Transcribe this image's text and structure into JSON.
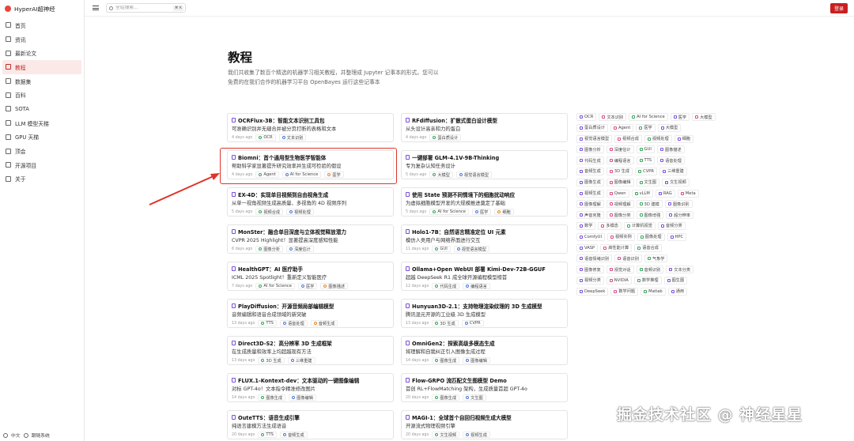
{
  "brand": {
    "name": "HyperAI超神经"
  },
  "nav": [
    {
      "label": "首页",
      "icon": "home-icon"
    },
    {
      "label": "资讯",
      "icon": "news-icon"
    },
    {
      "label": "最新论文",
      "icon": "paper-icon"
    },
    {
      "label": "教程",
      "icon": "book-icon",
      "active": true
    },
    {
      "label": "数据集",
      "icon": "dataset-icon"
    },
    {
      "label": "百科",
      "icon": "wiki-icon"
    },
    {
      "label": "SOTA",
      "icon": "trophy-icon"
    },
    {
      "label": "LLM 模型天梯",
      "icon": "ladder-icon"
    },
    {
      "label": "GPU 天梯",
      "icon": "gpu-icon"
    },
    {
      "label": "顶会",
      "icon": "conference-icon"
    },
    {
      "label": "开源项目",
      "icon": "opensource-icon"
    },
    {
      "label": "关于",
      "icon": "info-icon"
    }
  ],
  "footer": {
    "language": "中文",
    "theme": "跟随系统"
  },
  "search": {
    "placeholder": "全站搜索...",
    "shortcut": "⌘ K"
  },
  "login_label": "登录",
  "page": {
    "title": "教程",
    "description": "我们共收集了数百个精选的机器学习相关教程，并整理成 Jupyter 记事本的形式。您可以免费的在我们合作的机器学习平台 OpenBayes 运行这些记事本"
  },
  "cards": [
    {
      "title": "OCRFlux-3B：智能文本识别工具包",
      "subtitle": "可准确识别并无缝合并被分页打断的表格和文本",
      "days": "4 days ago",
      "tags": [
        "OCR",
        "文本识别"
      ]
    },
    {
      "title": "RFdiffusion：扩散式蛋白设计模型",
      "subtitle": "从头设计高亲和力的蛋白",
      "days": "4 days ago",
      "tags": [
        "蛋白质设计"
      ]
    },
    {
      "title": "Biomni：首个通用型生物医学智能体",
      "subtitle": "帮助科学家显著提升研究效率并生成可检验的假设",
      "days": "4 days ago",
      "tags": [
        "Agent",
        "AI for Science",
        "医学"
      ]
    },
    {
      "title": "一键部署 GLM-4.1V-9B-Thinking",
      "subtitle": "专为复杂认知任务设计",
      "days": "5 days ago",
      "tags": [
        "大模型",
        "视觉语言模型"
      ]
    },
    {
      "title": "EX-4D：实现单目视频到自由视角生成",
      "subtitle": "从单一视角视频生成高质量、多视角的 4D 视频序列",
      "days": "5 days ago",
      "tags": [
        "视频合成",
        "视频处理"
      ]
    },
    {
      "title": "使用 State 预测不同情境下的细胞扰动响应",
      "subtitle": "为虚拟细胞模型开发的大规模推进奠定了基础",
      "days": "5 days ago",
      "tags": [
        "AI for Science",
        "医学",
        "细胞"
      ]
    },
    {
      "title": "MonSter：融合单目深度与立体视觉释放潜力",
      "subtitle": "CVPR 2025 Highlight！显著提高深度感知性能",
      "days": "6 days ago",
      "tags": [
        "图像分析",
        "深度估计"
      ]
    },
    {
      "title": "Holo1-7B：自然语言精准定位 UI 元素",
      "subtitle": "模仿人类用户与网络界面进行交互",
      "days": "11 days ago",
      "tags": [
        "GUI",
        "视觉语言模型"
      ]
    },
    {
      "title": "HealthGPT：AI 医疗助手",
      "subtitle": "ICML 2025 Spotlight！重新定义智能医疗",
      "days": "7 days ago",
      "tags": [
        "AI for Science",
        "医学",
        "图像描述"
      ]
    },
    {
      "title": "Ollama+Open WebUI 部署 Kimi-Dev-72B-GGUF",
      "subtitle": "超越 DeepSeek R1 成全球开源编程模型榜首",
      "days": "12 days ago",
      "tags": [
        "代码生成",
        "编程语言"
      ]
    },
    {
      "title": "PlayDiffusion：开源音频局部编辑模型",
      "subtitle": "音频编辑和语音合成领域的新突破",
      "days": "13 days ago",
      "tags": [
        "TTS",
        "语音处理",
        "音频生成"
      ]
    },
    {
      "title": "Hunyuan3D-2.1：支持物理渲染纹理的 3D 生成模型",
      "subtitle": "腾讯混元开源的工业级 3D 生成模型",
      "days": "13 days ago",
      "tags": [
        "3D 生成",
        "CVPR"
      ]
    },
    {
      "title": "Direct3D-S2：高分辨率 3D 生成框架",
      "subtitle": "在生成质量和效率上均超越现有方法",
      "days": "13 days ago",
      "tags": [
        "3D 生成",
        "三维重建"
      ]
    },
    {
      "title": "OmniGen2：探索高级多模态生成",
      "subtitle": "将理解和自我纠正引入图像生成过程",
      "days": "14 days ago",
      "tags": [
        "图像生成",
        "图像编辑"
      ]
    },
    {
      "title": "FLUX.1-Kontext-dev：文本驱动的一键图像编辑",
      "subtitle": "对标 GPT-4o！文本指令精准修改图片",
      "days": "14 days ago",
      "tags": [
        "图像生成",
        "图像编辑"
      ]
    },
    {
      "title": "Flow-GRPO 流匹配文生图模型 Demo",
      "subtitle": "首创 RL+FlowMatching 架构，生成质量首超 GPT-4o",
      "days": "20 days ago",
      "tags": [
        "图像生成",
        "文生图"
      ]
    },
    {
      "title": "OuteTTS：语音生成引擎",
      "subtitle": "纯语言建模方法生成语音",
      "days": "20 days ago",
      "tags": [
        "TTS",
        "音频生成"
      ]
    },
    {
      "title": "MAGI-1：全球首个自回归视频生成大模型",
      "subtitle": "开源流式物理视频引擎",
      "days": "20 days ago",
      "tags": [
        "文生视频",
        "视频生成"
      ]
    }
  ],
  "tag_cloud": [
    [
      "OCR",
      "文本识别",
      "AI for Science",
      "医学",
      "大模型"
    ],
    [
      "蛋白质设计",
      "Agent",
      "医学",
      "大模型"
    ],
    [
      "视觉语言模型",
      "视频合成",
      "视频处理",
      "细胞"
    ],
    [
      "图像分析",
      "深度估计",
      "GUI",
      "图像描述"
    ],
    [
      "代码生成",
      "编程语言",
      "TTS",
      "语音处理"
    ],
    [
      "音频生成",
      "3D 生成",
      "CVPR",
      "三维重建"
    ],
    [
      "图像生成",
      "图像编辑",
      "文生图",
      "文生视频"
    ],
    [
      "视频生成",
      "Qwen",
      "vLLM",
      "RAG",
      "Meta"
    ],
    [
      "图像理解",
      "视频理解",
      "3D 建模",
      "图像识别"
    ],
    [
      "声音克隆",
      "图像分类",
      "图像增强",
      "超分辨率"
    ],
    [
      "数学",
      "多模态",
      "计算机视觉",
      "音频分类"
    ],
    [
      "ComfyUI",
      "视频实例",
      "图像处理",
      "HPC"
    ],
    [
      "VASP",
      "高性能计算",
      "语音合成"
    ],
    [
      "语音情绪识别",
      "语音识别",
      "气象学"
    ],
    [
      "图像修复",
      "视觉对话",
      "音频识别",
      "文本分类"
    ],
    [
      "视频分类",
      "NVIDIA",
      "数学推理",
      "图生图"
    ],
    [
      "DeepSeek",
      "数学问题",
      "Matlab",
      "通用"
    ]
  ],
  "watermark": "掘金技术社区 @ 神经星星"
}
